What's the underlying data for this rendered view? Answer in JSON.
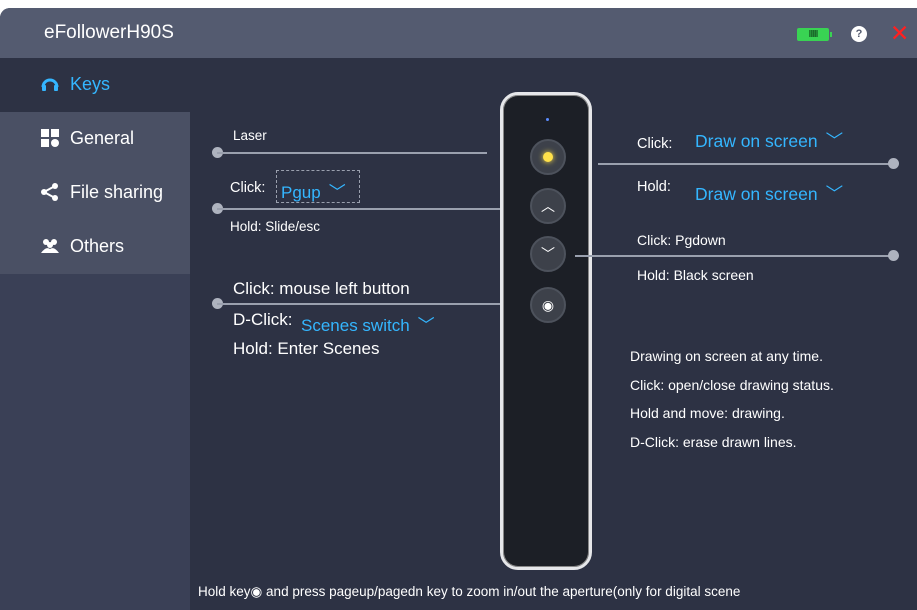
{
  "app": {
    "title": "eFollowerH90S"
  },
  "titlebar": {
    "battery_icon": "battery-full-icon",
    "help_label": "?",
    "close_label": "✕"
  },
  "sidebar": {
    "items": [
      {
        "label": "Keys",
        "icon": "remote-icon"
      },
      {
        "label": "General",
        "icon": "grid-icon"
      },
      {
        "label": "File sharing",
        "icon": "share-icon"
      },
      {
        "label": "Others",
        "icon": "users-icon"
      }
    ]
  },
  "keys": {
    "laser": {
      "label": "Laser"
    },
    "pgup": {
      "click_prefix": "Click:",
      "click_value": "Pgup",
      "hold_text": "Hold: Slide/esc"
    },
    "center": {
      "click_text": "Click: mouse left button",
      "dclick_prefix": "D-Click:",
      "dclick_value": "Scenes switch",
      "hold_text": "Hold:  Enter Scenes"
    },
    "top_right": {
      "click_prefix": "Click:",
      "click_value": "Draw on screen",
      "hold_prefix": "Hold:",
      "hold_value": "Draw on screen"
    },
    "pgdown": {
      "click_text": "Click:  Pgdown",
      "hold_text": "Hold: Black screen"
    },
    "info_lines": [
      "Drawing on screen at any time.",
      "Click:  open/close drawing status.",
      "Hold and move:  drawing.",
      "D-Click: erase drawn lines."
    ],
    "bottom_note": "Hold key◉ and press pageup/pagedn key to zoom in/out the aperture(only for digital scene",
    "chevron": "﹀"
  }
}
